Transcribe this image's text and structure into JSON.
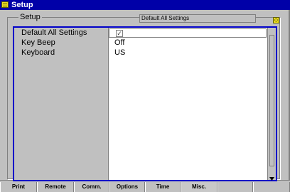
{
  "window": {
    "title": "Setup",
    "group_label": "Setup",
    "default_all_button": "Default All Settings",
    "indicator_glyph": "◇",
    "accent_color": "#0000a8"
  },
  "settings": [
    {
      "label": "Default All Settings",
      "value": "",
      "type": "checkbox",
      "checked": true
    },
    {
      "label": "Key Beep",
      "value": "Off",
      "type": "text"
    },
    {
      "label": "Keyboard",
      "value": "US",
      "type": "text"
    }
  ],
  "checkbox_glyph": "✓",
  "tabs": [
    {
      "label": "Print",
      "active": false
    },
    {
      "label": "Remote",
      "active": false
    },
    {
      "label": "Comm.",
      "active": false
    },
    {
      "label": "Options",
      "active": false
    },
    {
      "label": "Time",
      "active": false
    },
    {
      "label": "Misc.",
      "active": true
    },
    {
      "label": "",
      "active": false
    },
    {
      "label": "",
      "active": false
    }
  ]
}
